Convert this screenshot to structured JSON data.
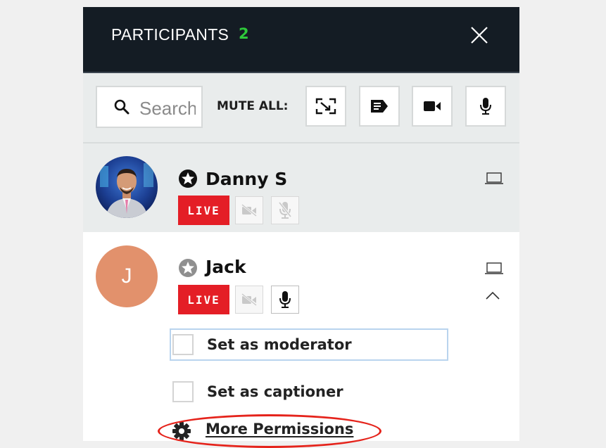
{
  "header": {
    "title": "PARTICIPANTS",
    "count": "2"
  },
  "toolbar": {
    "search_placeholder": "Search",
    "mute_all_label": "MUTE ALL:",
    "buttons": [
      "screen-share-icon",
      "chat-icon",
      "video-camera-icon",
      "microphone-icon"
    ]
  },
  "participants": [
    {
      "name": "Danny S",
      "status": "LIVE",
      "role_icon": "star-badge-icon",
      "camera": "off",
      "microphone": "off",
      "device": "laptop-icon"
    },
    {
      "name": "Jack",
      "initial": "J",
      "status": "LIVE",
      "role_icon": "star-badge-icon",
      "camera": "off",
      "microphone": "on",
      "device": "laptop-icon",
      "permissions": {
        "moderator_label": "Set as moderator",
        "captioner_label": "Set as captioner",
        "more_label": "More Permissions"
      }
    }
  ],
  "colors": {
    "header_bg": "#141c24",
    "count": "#2ec93a",
    "live": "#e41e26",
    "avatar_jack": "#e2916c",
    "highlight_oval": "#e5231b"
  }
}
